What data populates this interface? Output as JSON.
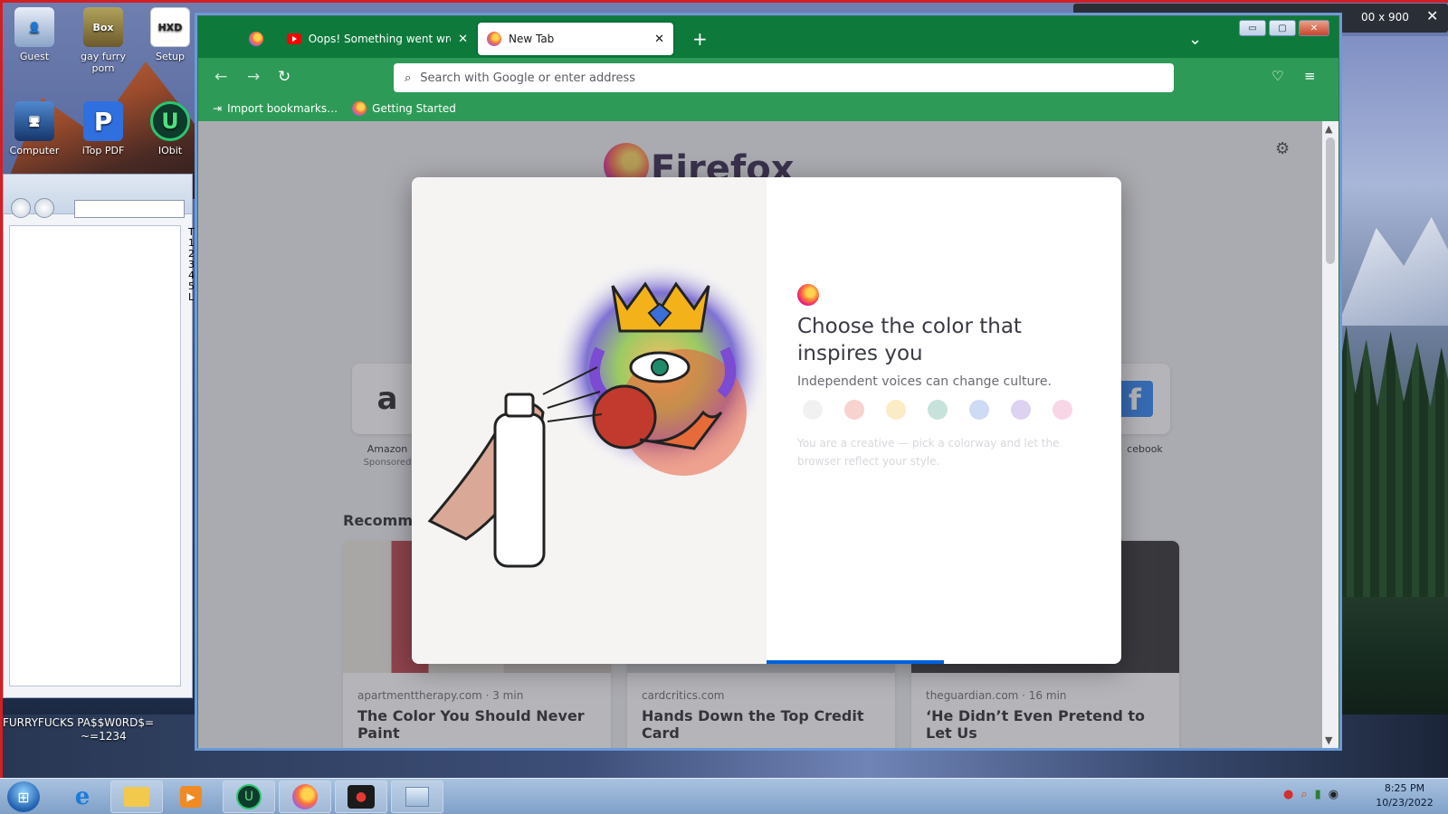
{
  "desktop": {
    "icons": [
      {
        "label": "Guest"
      },
      {
        "label": "gay furry porn",
        "badge": "Box"
      },
      {
        "label": "Setup",
        "badge": "HXD"
      },
      {
        "label": "Computer"
      },
      {
        "label": "iTop PDF",
        "badge": "P"
      },
      {
        "label": "IObit Uninstaller",
        "badge": "U"
      }
    ],
    "overlay_text_line1": "FURRYFUCKS PA$$W0RD$=",
    "overlay_text_line2": "~=1234",
    "side_window_edge_text": "T 1 2 3 4 5 L",
    "screen_size_label": "00 x 900"
  },
  "browser": {
    "tabs": [
      {
        "label": "",
        "icon": "firefox-icon"
      },
      {
        "label": "Oops! Something went wrong.",
        "icon": "youtube-icon"
      },
      {
        "label": "New Tab",
        "icon": "firefox-icon",
        "active": true
      }
    ],
    "new_tab_symbol": "+",
    "tab_list_symbol": "⌄",
    "close_symbol": "✕",
    "search_placeholder": "Search with Google or enter address",
    "bookmarks": [
      {
        "label": "Import bookmarks…"
      },
      {
        "label": "Getting Started"
      }
    ],
    "window_buttons": {
      "minimize": "▭",
      "maximize": "▢",
      "close": "✕"
    }
  },
  "newtab": {
    "brand": "Firefox",
    "shortcuts": [
      {
        "label": "Amazon",
        "sub": "Sponsored",
        "glyph": "a"
      },
      {
        "label": "Facebook",
        "sub": "",
        "glyph": "f"
      }
    ],
    "facebook_visible_label": "cebook",
    "recommended_heading": "Recomme",
    "stories": [
      {
        "source": "apartmenttherapy.com · 3 min",
        "title": "The Color You Should Never Paint"
      },
      {
        "source": "cardcritics.com",
        "title": "Hands Down the Top Credit Card"
      },
      {
        "source": "theguardian.com · 16 min",
        "title": "‘He Didn’t Even Pretend to Let Us"
      }
    ]
  },
  "modal": {
    "title": "Choose the color that inspires you",
    "subtitle": "Independent voices can change culture.",
    "faint_text": "You are a creative — pick a colorway and let the browser reflect your style.",
    "accent_color": "#0060df"
  },
  "taskbar": {
    "time": "8:25 PM",
    "date": "10/23/2022"
  }
}
